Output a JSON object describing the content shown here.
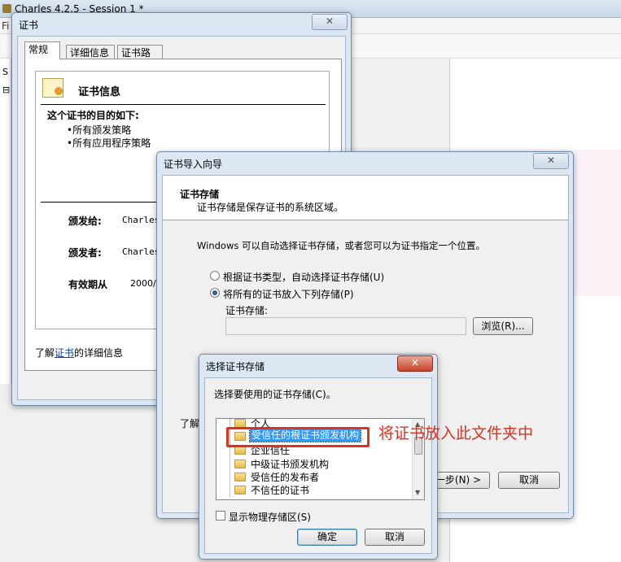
{
  "charles": {
    "title": "Charles 4.2.5 - Session 1 *",
    "menu_partial": "Fi",
    "left_labels": [
      "S",
      "⊟"
    ]
  },
  "cert_window": {
    "title": "证书",
    "close": "✕",
    "tabs": [
      "常规",
      "详细信息",
      "证书路径"
    ],
    "info_heading": "证书信息",
    "purpose_heading": "这个证书的目的如下:",
    "purposes": [
      "•所有颁发策略",
      "•所有应用程序策略"
    ],
    "issued_to_label": "颁发给:",
    "issued_to_value": "Charles",
    "issued_by_label": "颁发者:",
    "issued_by_value": "Charles",
    "valid_from_label": "有效期从",
    "valid_from_value": "2000/",
    "learn_more_prefix": "了解",
    "learn_more_link": "证书",
    "learn_more_suffix": "的详细信息"
  },
  "wizard": {
    "title": "证书导入向导",
    "close": "✕",
    "section_title": "证书存储",
    "section_desc": "证书存储是保存证书的系统区域。",
    "intro": "Windows 可以自动选择证书存储，或者您可以为证书指定一个位置。",
    "radio_auto": "根据证书类型，自动选择证书存储(U)",
    "radio_manual": "将所有的证书放入下列存储(P)",
    "store_label": "证书存储:",
    "store_value": "",
    "browse_button": "浏览(R)...",
    "learn_partial": "了解",
    "next_button": "一步(N) >",
    "cancel_button": "取消"
  },
  "select_store": {
    "title": "选择证书存储",
    "close": "✕",
    "prompt": "选择要使用的证书存储(C)。",
    "items": [
      "个人",
      "受信任的根证书颁发机构",
      "企业信任",
      "中级证书颁发机构",
      "受信任的发布者",
      "不信任的证书"
    ],
    "selected_index": 1,
    "show_physical": "显示物理存储区(S)",
    "ok_button": "确定",
    "cancel_button": "取消"
  },
  "annotation": {
    "text": "将证书放入此文件夹中",
    "color": "#e0301e"
  }
}
